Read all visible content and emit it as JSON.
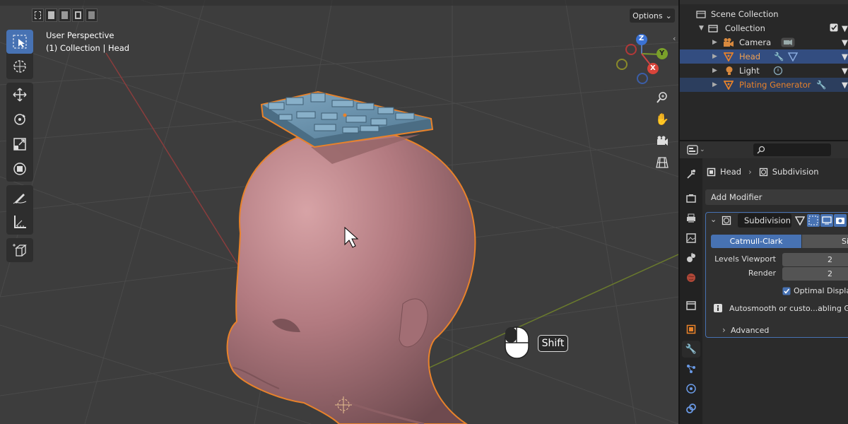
{
  "viewport": {
    "perspective": "User Perspective",
    "context": "(1) Collection | Head",
    "options_label": "Options",
    "shift_key": "Shift",
    "axes": {
      "z": "Z",
      "y": "Y",
      "x": "X"
    }
  },
  "outliner": {
    "scene_collection": "Scene Collection",
    "collection": "Collection",
    "items": [
      {
        "label": "Camera"
      },
      {
        "label": "Head"
      },
      {
        "label": "Light"
      },
      {
        "label": "Plating Generator"
      }
    ]
  },
  "properties": {
    "breadcrumb_object": "Head",
    "breadcrumb_modifier": "Subdivision",
    "add_modifier": "Add Modifier",
    "modifier_name": "Subdivision",
    "catmull_clark": "Catmull-Clark",
    "simple": "Simple",
    "levels_viewport_label": "Levels Viewport",
    "levels_viewport_value": "2",
    "render_label": "Render",
    "render_value": "2",
    "optimal_display": "Optimal Display",
    "info_text": "Autosmooth or custo...abling GPU",
    "advanced": "Advanced"
  },
  "colors": {
    "accent": "#4772b3",
    "selection": "#334d80",
    "outline": "#e8822a",
    "skin": "#b57a80",
    "plate": "#6a8fa8"
  }
}
